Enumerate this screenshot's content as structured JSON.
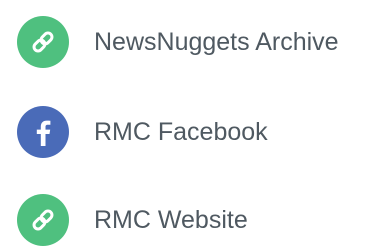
{
  "links": [
    {
      "label": "NewsNuggets Archive",
      "icon": "link-icon",
      "color": "#4fc07f"
    },
    {
      "label": "RMC Facebook",
      "icon": "facebook-icon",
      "color": "#4a6bb8"
    },
    {
      "label": "RMC Website",
      "icon": "link-icon",
      "color": "#4fc07f"
    }
  ]
}
